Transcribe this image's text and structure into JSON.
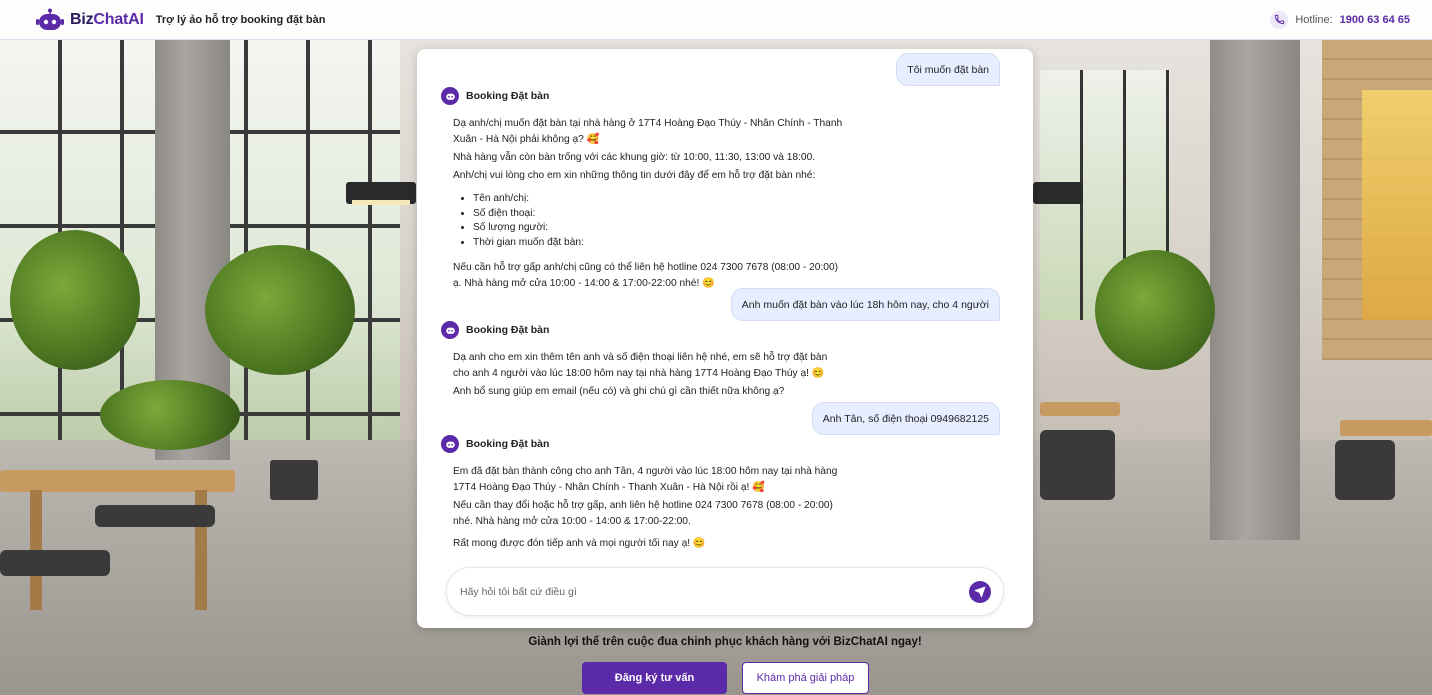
{
  "header": {
    "brand_a": "Biz",
    "brand_b": "ChatAI",
    "tagline": "Trợ lý ảo hỗ trợ booking đặt bàn",
    "hotline_label": "Hotline:",
    "hotline_number": "1900 63 64 65"
  },
  "chat": {
    "bot_name": "Booking Đặt bàn",
    "messages": [
      {
        "role": "user",
        "text": "Tôi muốn đặt bàn"
      },
      {
        "role": "bot",
        "p1": "Dạ anh/chị muốn đặt bàn tại nhà hàng ở 17T4 Hoàng Đạo Thúy - Nhân Chính - Thanh Xuân - Hà Nội phải không ạ? 🥰",
        "p2": "Nhà hàng vẫn còn bàn trống với các khung giờ: từ 10:00, 11:30, 13:00 và 18:00.",
        "p3": "Anh/chị vui lòng cho em xin những thông tin dưới đây để em hỗ trợ đặt bàn nhé:",
        "list": [
          "Tên anh/chị:",
          "Số điện thoại:",
          "Số lượng người:",
          "Thời gian muốn đặt bàn:"
        ],
        "p4": "Nếu cần hỗ trợ gấp anh/chị cũng có thể liên hệ hotline 024 7300 7678 (08:00 - 20:00) ạ. Nhà hàng mở cửa 10:00 - 14:00 & 17:00-22:00 nhé! 😊"
      },
      {
        "role": "user",
        "text": "Anh muốn đặt bàn vào lúc 18h hôm nay, cho 4 người"
      },
      {
        "role": "bot",
        "p1": "Dạ anh cho em xin thêm tên anh và số điện thoại liên hệ nhé, em sẽ hỗ trợ đặt bàn cho anh 4 người vào lúc 18:00 hôm nay tại nhà hàng 17T4 Hoàng Đạo Thúy ạ! 😊",
        "p2": "Anh bổ sung giúp em email (nếu có) và ghi chú gì cần thiết nữa không ạ?"
      },
      {
        "role": "user",
        "text": "Anh Tân, số điện thoại 0949682125"
      },
      {
        "role": "bot",
        "p1": "Em đã đặt bàn thành công cho anh Tân, 4 người vào lúc 18:00 hôm nay tại nhà hàng 17T4 Hoàng Đạo Thúy - Nhân Chính - Thanh Xuân - Hà Nội rồi ạ! 🥰",
        "p2": "Nếu cần thay đổi hoặc hỗ trợ gấp, anh liên hệ hotline 024 7300 7678 (08:00 - 20:00) nhé. Nhà hàng mở cửa 10:00 - 14:00 & 17:00-22:00.",
        "p3": "Rất mong được đón tiếp anh và mọi người tối nay ạ! 😊"
      }
    ],
    "input_placeholder": "Hãy hỏi tôi bất cứ điều gì"
  },
  "cta": {
    "text": "Giành lợi thế trên cuộc đua chinh phục khách hàng với BizChatAI ngay!",
    "primary": "Đăng ký tư vấn",
    "secondary": "Khám phá giải pháp"
  },
  "colors": {
    "brand": "#5b2aa8",
    "user_bubble": "#e6eeff"
  },
  "icons": [
    "robot-logo-icon",
    "phone-icon",
    "bot-avatar-icon",
    "send-icon"
  ]
}
